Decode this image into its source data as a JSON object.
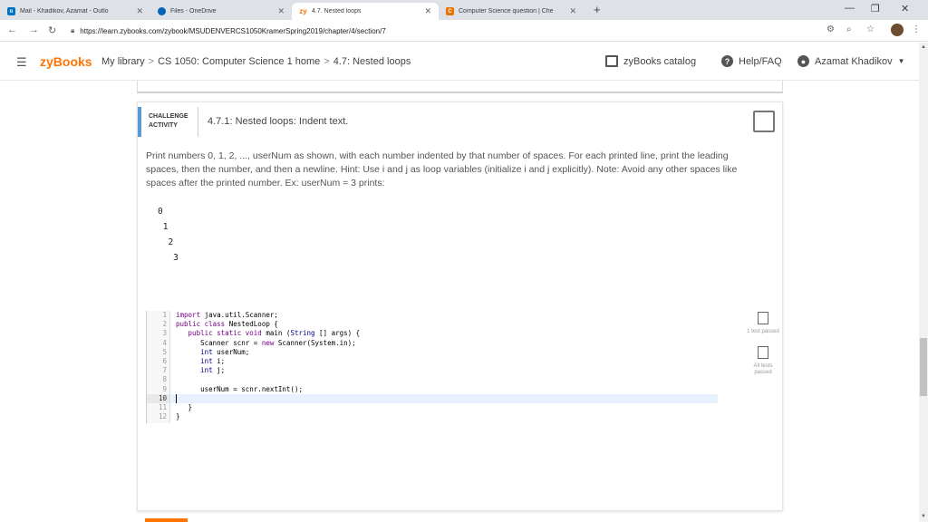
{
  "browser": {
    "tabs": [
      {
        "title": "Mail - Khadikov, Azamat - Outlo",
        "icon": "outlook-icon",
        "color": "#0072c6"
      },
      {
        "title": "Files - OneDrive",
        "icon": "onedrive-icon",
        "color": "#0364b8"
      },
      {
        "title": "4.7. Nested loops",
        "icon": "zybooks-icon",
        "color": "#ff7300"
      },
      {
        "title": "Computer Science question | Che",
        "icon": "chegg-icon",
        "color": "#eb7100"
      }
    ],
    "url": "https://learn.zybooks.com/zybook/MSUDENVERCS1050KramerSpring2019/chapter/4/section/7"
  },
  "header": {
    "brand": "zyBooks",
    "crumbs": [
      "My library",
      "CS 1050: Computer Science 1 home",
      "4.7: Nested loops"
    ],
    "catalog": "zyBooks catalog",
    "help": "Help/FAQ",
    "user": "Azamat Khadikov"
  },
  "activity": {
    "badge_line1": "CHALLENGE",
    "badge_line2": "ACTIVITY",
    "title": "4.7.1: Nested loops: Indent text.",
    "prompt": "Print numbers 0, 1, 2, ..., userNum as shown, with each number indented by that number of spaces. For each printed line, print the leading spaces, then the number, and then a newline. Hint: Use i and j as loop variables (initialize i and j explicitly). Note: Avoid any other spaces like spaces after the printed number. Ex: userNum = 3 prints:",
    "example": [
      "0",
      " 1",
      "  2",
      "   3"
    ],
    "line_numbers": [
      "1",
      "2",
      "3",
      "4",
      "5",
      "6",
      "7",
      "8",
      "9",
      "10",
      "11",
      "12"
    ],
    "test1": "1 test passed",
    "test_all": "All tests passed"
  }
}
